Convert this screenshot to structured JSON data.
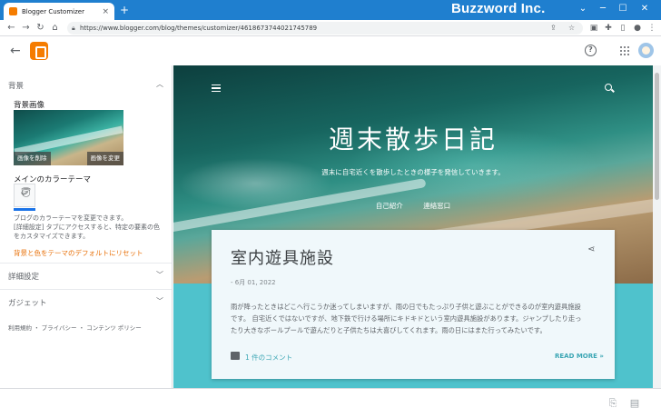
{
  "browser": {
    "tab_title": "Blogger Customizer",
    "tab_close": "×",
    "new_tab": "+",
    "url": "https://www.blogger.com/blog/themes/customizer/4618673744021745789",
    "watermark": "Buzzword Inc.",
    "window_controls": [
      "⌄",
      "─",
      "☐",
      "✕"
    ]
  },
  "header": {
    "help": "?"
  },
  "panel": {
    "background_section": "背景",
    "background_image_label": "背景画像",
    "remove_image_button": "画像を削除",
    "change_image_button": "画像を変更",
    "main_color_theme_label": "メインのカラーテーマ",
    "help_text_line1": "ブログのカラーテーマを変更できます。",
    "help_text_line2": "[詳細設定] タブにアクセスすると、特定の要素の色",
    "help_text_line3": "をカスタマイズできます。",
    "reset_link": "背景と色をテーマのデフォルトにリセット",
    "advanced_section": "詳細設定",
    "gadget_section": "ガジェット",
    "footer_terms": "利用規約",
    "footer_privacy": "プライバシー",
    "footer_content_policy": "コンテンツ ポリシー",
    "footer_sep": "・"
  },
  "preview": {
    "blog_title": "週末散歩日記",
    "blog_description": "週末に自宅近くを散歩したときの様子を発信していきます。",
    "nav_about": "自己紹介",
    "nav_contact": "連絡窓口",
    "post": {
      "title": "室内遊具施設",
      "date": "- 6月 01, 2022",
      "body_line1": "雨が降ったときはどこへ行こうか迷ってしまいますが、雨の日でもたっぷり子供と遊ぶことができるのが室内遊具施設",
      "body_line2": "です。 自宅近くではないですが、地下鉄で行ける場所にキドキドという室内遊具施設があります。ジャンプしたり走っ",
      "body_line3": "たり大きなボールプールで遊んだりと子供たちは大喜びしてくれます。雨の日にはまた行ってみたいです。",
      "comments": "1 件のコメント",
      "read_more": "READ MORE »"
    }
  },
  "colors": {
    "chrome_blue": "#1f7fcf",
    "blogger_orange": "#f57c00",
    "reset_link": "#e8710a",
    "link_teal": "#3ba6b4",
    "selected_blue": "#1a73e8"
  }
}
